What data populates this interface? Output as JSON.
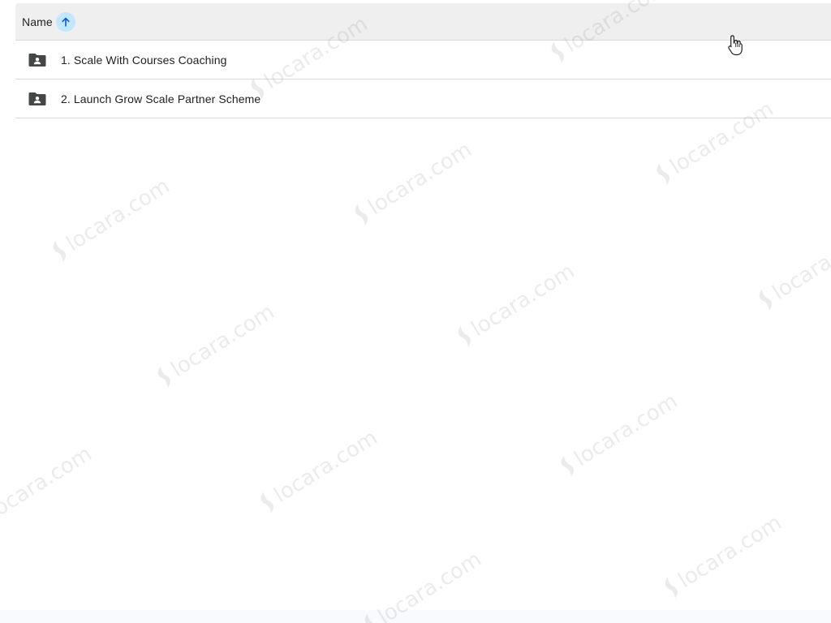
{
  "list": {
    "header": {
      "name_label": "Name",
      "sort_direction": "ascending",
      "sort_icon": "arrow-up-icon"
    },
    "rows": [
      {
        "label": "1. Scale With Courses Coaching",
        "icon": "shared-folder-icon"
      },
      {
        "label": "2. Launch Grow Scale Partner Scheme",
        "icon": "shared-folder-icon"
      }
    ]
  },
  "watermark": {
    "text": "locara.com"
  },
  "colors": {
    "header_bg": "#efefef",
    "sort_active_bg": "#c2e7ff",
    "sort_arrow": "#0b57d0",
    "folder_icon": "#444746",
    "divider": "#d9d9d9"
  }
}
